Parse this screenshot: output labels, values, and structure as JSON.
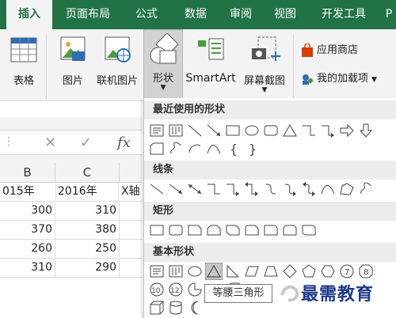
{
  "tabs": [
    "插入",
    "页面布局",
    "公式",
    "数据",
    "审阅",
    "视图",
    "开发工具",
    "P"
  ],
  "ribbon": {
    "table_label": "表格",
    "picture_label": "图片",
    "online_picture_label": "联机图片",
    "shapes_label": "形状",
    "smartart_label": "SmartArt",
    "screenshot_label": "屏幕截图",
    "app_store_label": "应用商店",
    "my_addins_label": "我的加载项"
  },
  "formula_bar": {
    "cancel": "✕",
    "enter": "✓",
    "fx": "fx"
  },
  "grid": {
    "columns": [
      "B",
      "C"
    ],
    "header_row": [
      "015年",
      "2016年",
      "X轴"
    ],
    "rows": [
      [
        "300",
        "310"
      ],
      [
        "370",
        "380"
      ],
      [
        "260",
        "250"
      ],
      [
        "310",
        "290"
      ]
    ]
  },
  "shapes_menu": {
    "recent_title": "最近使用的形状",
    "lines_title": "线条",
    "rect_title": "矩形",
    "basic_title": "基本形状",
    "basic_numbers": [
      "10",
      "12"
    ],
    "basic_row2": [
      "10",
      "12"
    ]
  },
  "tooltip": "等腰三角形",
  "watermark": "最需教育",
  "colors": {
    "accent": "#217346",
    "ribbon_bg": "#f3f3f3",
    "watermark": "#1b3a8a"
  }
}
